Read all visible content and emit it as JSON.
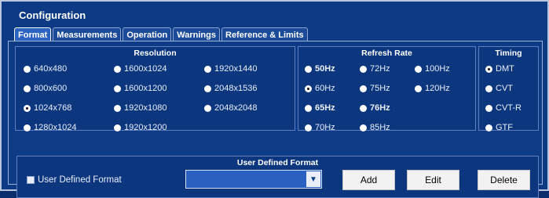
{
  "title": "Configuration",
  "tabs": [
    {
      "label": "Format"
    },
    {
      "label": "Measurements"
    },
    {
      "label": "Operation"
    },
    {
      "label": "Warnings"
    },
    {
      "label": "Reference & Limits"
    }
  ],
  "resolution": {
    "title": "Resolution",
    "options": [
      "640x480",
      "1600x1024",
      "1920x1440",
      "800x600",
      "1600x1200",
      "2048x1536",
      "1024x768",
      "1920x1080",
      "2048x2048",
      "1280x1024",
      "1920x1200"
    ],
    "selected": "1024x768"
  },
  "refresh": {
    "title": "Refresh Rate",
    "options": [
      "50Hz",
      "72Hz",
      "100Hz",
      "60Hz",
      "75Hz",
      "120Hz",
      "65Hz",
      "76Hz",
      "70Hz",
      "85Hz"
    ],
    "selected": "60Hz"
  },
  "timing": {
    "title": "Timing",
    "options": [
      "DMT",
      "CVT",
      "CVT-R",
      "GTF"
    ],
    "selected": "DMT"
  },
  "user_defined": {
    "title": "User Defined Format",
    "checkbox_label": "User Defined Format",
    "select_value": "",
    "buttons": {
      "add": "Add",
      "edit": "Edit",
      "delete": "Delete"
    }
  },
  "colors": {
    "background": "#0d3a84",
    "accent": "#2a60bf"
  }
}
